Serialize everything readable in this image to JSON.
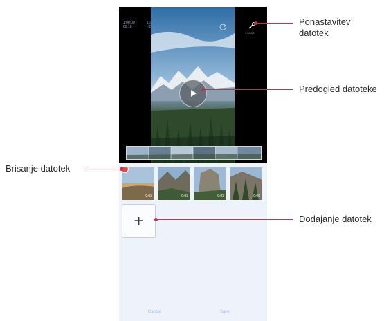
{
  "status": {
    "info_line1": "1:00:00",
    "info_line2": "00:18",
    "resolution_line1": "1080",
    "resolution_line2": "HD",
    "settings_sublabel": "1:00:00"
  },
  "clips": [
    {
      "duration": "0:03"
    },
    {
      "duration": "0:03"
    },
    {
      "duration": "0:03"
    },
    {
      "duration": "0:06"
    }
  ],
  "actions": {
    "add_symbol": "+",
    "cancel_label": "Cancel",
    "save_label": "Save"
  },
  "callouts": {
    "settings": "Ponastavitev\ndatotek",
    "preview": "Predogled datoteke",
    "delete": "Brisanje datotek",
    "add": "Dodajanje datotek"
  },
  "colors": {
    "callout": "#c4304e",
    "delete_badge": "#e6483a",
    "accent_text": "#9fbbe6"
  }
}
